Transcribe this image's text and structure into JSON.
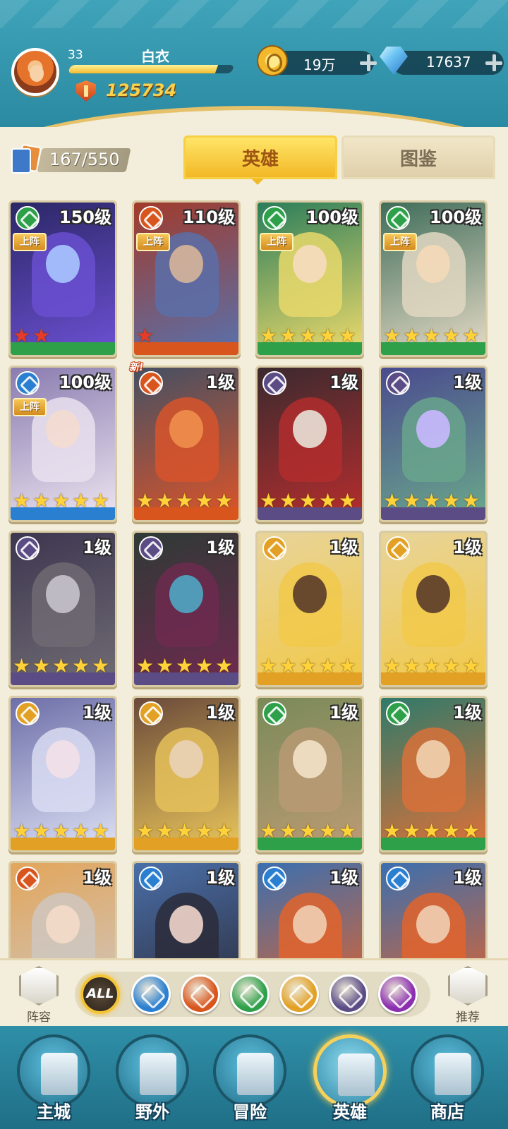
{
  "player": {
    "level": "33",
    "name": "白衣",
    "exp_fraction": 0.9,
    "power": "125734"
  },
  "resources": {
    "gold": "19万",
    "gems": "17637",
    "gold_icon": "coin-icon",
    "gem_icon": "diamond-icon"
  },
  "hero_count": "167/550",
  "tabs": [
    {
      "label": "英雄",
      "active": true
    },
    {
      "label": "图鉴",
      "active": false
    }
  ],
  "faction_colors": {
    "wind": "#2ea04a",
    "fire": "#d8561e",
    "water": "#2a7fd0",
    "dark": "#5b4c86",
    "light": "#e2a024",
    "void": "#8b2fb0"
  },
  "heroes": [
    {
      "level": "150级",
      "faction": "wind",
      "stars": 2,
      "star_color": "red",
      "deployed": true,
      "deploy_label": "上阵",
      "new": false,
      "art": [
        "#2b2766",
        "#6a4fd0",
        "#a8c7ff"
      ]
    },
    {
      "level": "110级",
      "faction": "fire",
      "stars": 1,
      "star_color": "red",
      "deployed": true,
      "deploy_label": "上阵",
      "new": false,
      "art": [
        "#a13b2b",
        "#5b6fa8",
        "#d7b59a"
      ]
    },
    {
      "level": "100级",
      "faction": "wind",
      "stars": 5,
      "star_color": "gold",
      "deployed": true,
      "deploy_label": "上阵",
      "new": false,
      "art": [
        "#2a7d5a",
        "#e8d86b",
        "#f6dcc0"
      ]
    },
    {
      "level": "100级",
      "faction": "wind",
      "stars": 5,
      "star_color": "gold",
      "deployed": true,
      "deploy_label": "上阵",
      "new": false,
      "art": [
        "#3f6d5a",
        "#e0d7c2",
        "#f3d9b8"
      ]
    },
    {
      "level": "100级",
      "faction": "water",
      "stars": 5,
      "star_color": "gold",
      "deployed": true,
      "deploy_label": "上阵",
      "new": false,
      "art": [
        "#8a7cb0",
        "#e9e1ee",
        "#f4dcd0"
      ]
    },
    {
      "level": "1级",
      "faction": "fire",
      "stars": 5,
      "star_color": "gold",
      "deployed": false,
      "deploy_label": "",
      "new": true,
      "new_label": "新!",
      "art": [
        "#445063",
        "#d7542b",
        "#f08f4e"
      ]
    },
    {
      "level": "1级",
      "faction": "dark",
      "stars": 5,
      "star_color": "gold",
      "deployed": false,
      "deploy_label": "",
      "new": false,
      "art": [
        "#3a2a2f",
        "#b22d2d",
        "#e8e2d8"
      ]
    },
    {
      "level": "1级",
      "faction": "dark",
      "stars": 5,
      "star_color": "gold",
      "deployed": false,
      "deploy_label": "",
      "new": false,
      "art": [
        "#4a4b8e",
        "#69a58c",
        "#c9b8ff"
      ]
    },
    {
      "level": "1级",
      "faction": "dark",
      "stars": 5,
      "star_color": "gold",
      "deployed": false,
      "deploy_label": "",
      "new": false,
      "art": [
        "#3d3650",
        "#6e6a72",
        "#c8c3cc"
      ]
    },
    {
      "level": "1级",
      "faction": "dark",
      "stars": 5,
      "star_color": "gold",
      "deployed": false,
      "deploy_label": "",
      "new": false,
      "art": [
        "#2e3a35",
        "#6d2a4f",
        "#4fa6c4"
      ]
    },
    {
      "level": "1级",
      "faction": "light",
      "stars": 5,
      "star_color": "gold",
      "deployed": false,
      "deploy_label": "",
      "new": false,
      "art": [
        "#e8d49a",
        "#f1c94a",
        "#5a3b2a"
      ]
    },
    {
      "level": "1级",
      "faction": "light",
      "stars": 5,
      "star_color": "gold",
      "deployed": false,
      "deploy_label": "",
      "new": false,
      "art": [
        "#e8d49a",
        "#f1c94a",
        "#5a3b2a"
      ]
    },
    {
      "level": "1级",
      "faction": "light",
      "stars": 5,
      "star_color": "gold",
      "deployed": false,
      "deploy_label": "",
      "new": false,
      "art": [
        "#6d6fa8",
        "#d9dcf2",
        "#f2e0e8"
      ]
    },
    {
      "level": "1级",
      "faction": "light",
      "stars": 5,
      "star_color": "gold",
      "deployed": false,
      "deploy_label": "",
      "new": false,
      "art": [
        "#6a4a3a",
        "#e5c15a",
        "#e9d2b8"
      ]
    },
    {
      "level": "1级",
      "faction": "wind",
      "stars": 5,
      "star_color": "gold",
      "deployed": false,
      "deploy_label": "",
      "new": false,
      "art": [
        "#7a8a58",
        "#b99a74",
        "#f2e2c6"
      ]
    },
    {
      "level": "1级",
      "faction": "wind",
      "stars": 5,
      "star_color": "gold",
      "deployed": false,
      "deploy_label": "",
      "new": false,
      "art": [
        "#2f7a6a",
        "#d8713a",
        "#f0d2b0"
      ]
    },
    {
      "level": "1级",
      "faction": "fire",
      "stars": 0,
      "star_color": "gold",
      "deployed": false,
      "deploy_label": "",
      "new": false,
      "art": [
        "#e2a55a",
        "#cfc7c0",
        "#f3dcc8"
      ]
    },
    {
      "level": "1级",
      "faction": "water",
      "stars": 0,
      "star_color": "gold",
      "deployed": false,
      "deploy_label": "",
      "new": false,
      "art": [
        "#4a6fa8",
        "#2b2b3a",
        "#f1d6cc"
      ]
    },
    {
      "level": "1级",
      "faction": "water",
      "stars": 0,
      "star_color": "gold",
      "deployed": false,
      "deploy_label": "",
      "new": false,
      "art": [
        "#3a6fb0",
        "#e2642b",
        "#f0cfb2"
      ]
    },
    {
      "level": "1级",
      "faction": "water",
      "stars": 0,
      "star_color": "gold",
      "deployed": false,
      "deploy_label": "",
      "new": false,
      "art": [
        "#3a6fb0",
        "#e2642b",
        "#f0cfb2"
      ]
    }
  ],
  "filter": {
    "lineup_label": "阵容",
    "lineup_icon": "lineup-icon",
    "recommend_label": "推荐",
    "recommend_icon": "thumbs-up-icon",
    "all_label": "ALL",
    "factions": [
      "water",
      "fire",
      "wind",
      "light",
      "dark",
      "void"
    ]
  },
  "nav": [
    {
      "label": "主城",
      "icon": "castle-icon",
      "active": false
    },
    {
      "label": "野外",
      "icon": "portal-icon",
      "active": false
    },
    {
      "label": "冒险",
      "icon": "sword-icon",
      "active": false
    },
    {
      "label": "英雄",
      "icon": "knight-helmet-icon",
      "active": true
    },
    {
      "label": "商店",
      "icon": "shop-icon",
      "active": false
    }
  ]
}
